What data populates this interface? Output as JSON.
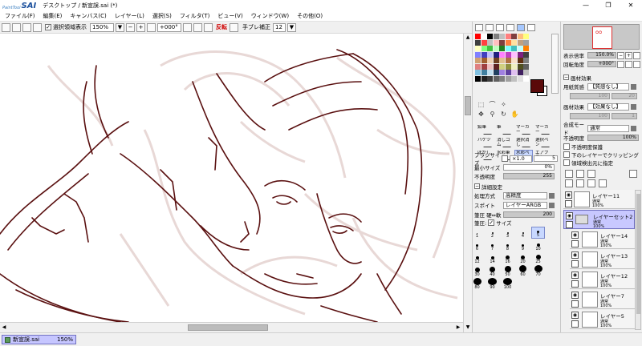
{
  "window": {
    "logo_small": "PaintTool",
    "logo_big": "SAI",
    "title": "デスクトップ / 新宣誤.sai (*)",
    "minimize": "—",
    "maximize": "❐",
    "close": "✕"
  },
  "menu": [
    "ファイル(F)",
    "編集(E)",
    "キャンバス(C)",
    "レイヤー(L)",
    "選択(S)",
    "フィルタ(T)",
    "ビュー(V)",
    "ウィンドウ(W)",
    "その他(O)"
  ],
  "toolbar": {
    "selection_display": "選択領域表示",
    "selection_checked": true,
    "zoom": "150%",
    "rotation": "+000°",
    "flip": "反転",
    "stabilizer_label": "手ブレ補正",
    "stabilizer_value": "12"
  },
  "palette_colors": [
    "#ff0000",
    "#ffffff",
    "#000000",
    "#7f7f7f",
    "#bfbfbf",
    "#ff7f7f",
    "#7f3f3f",
    "#ffbf7f",
    "#ffff7f",
    "#3f3f3f",
    "#ff4040",
    "#c0c0c0",
    "#ffc0c0",
    "#804040",
    "#ff8040",
    "#ffe0a0",
    "#c0a080",
    "#a0a0a0",
    "#ffffc0",
    "#80ff80",
    "#40c040",
    "#c0ffc0",
    "#208020",
    "#80ffff",
    "#40c0c0",
    "#c0ffff",
    "#ff8000",
    "#8080ff",
    "#4040c0",
    "#c0c0ff",
    "#202080",
    "#ff80ff",
    "#c040c0",
    "#ffc0ff",
    "#802080",
    "#404040",
    "#d0a070",
    "#a06030",
    "#f0d0b0",
    "#704020",
    "#e0c090",
    "#b07040",
    "#f8e0c8",
    "#603010",
    "#808080",
    "#e08080",
    "#a04040",
    "#f0c0c0",
    "#602020",
    "#d0d080",
    "#909040",
    "#f0f0c0",
    "#505020",
    "#606060",
    "#80c0e0",
    "#4080a0",
    "#c0e0f0",
    "#204060",
    "#a080e0",
    "#6040a0",
    "#e0c0f0",
    "#402060",
    "#c0c0c0",
    "#000000",
    "#202020",
    "#404040",
    "#606060",
    "#808080",
    "#a0a0a0",
    "#c0c0c0",
    "#e0e0e0",
    "#ffffff"
  ],
  "current_color": "#5a0a0a",
  "tools": [
    {
      "label": "鉛筆",
      "active": false
    },
    {
      "label": "筆",
      "active": false
    },
    {
      "label": "マーカー",
      "active": false
    },
    {
      "label": "マーカー",
      "active": false
    },
    {
      "label": "バケツ",
      "active": false
    },
    {
      "label": "消しゴム",
      "active": false
    },
    {
      "label": "選択消し",
      "active": false
    },
    {
      "label": "選択ペン",
      "active": false
    },
    {
      "label": "ぼかし",
      "active": false
    },
    {
      "label": "水彩筆",
      "active": false
    },
    {
      "label": "水彩ペン",
      "active": true
    },
    {
      "label": "エアブラシ",
      "active": false
    }
  ],
  "brush": {
    "size_label": "ブラシサイズ",
    "size_mult": "×1.0",
    "size_value": "5",
    "min_size_label": "最小サイズ",
    "min_size_value": "0%",
    "density_label": "不透明度",
    "density_value": "255",
    "detail_label": "詳細設定",
    "quality_label": "処理方式",
    "quality_value": "高精度",
    "edge_label": "スポイト",
    "edge_value": "レイヤーARGB",
    "hardness_label": "筆圧 硬⇔軟",
    "hardness_value": "200",
    "pressure_label": "筆圧:",
    "pressure_size": "サイズ"
  },
  "brush_sizes": [
    {
      "label": "1",
      "sel": false
    },
    {
      "label": "2",
      "sel": false
    },
    {
      "label": "3",
      "sel": false
    },
    {
      "label": "4",
      "sel": false
    },
    {
      "label": "5",
      "sel": true
    },
    {
      "label": "6",
      "sel": false
    },
    {
      "label": "7",
      "sel": false
    },
    {
      "label": "8",
      "sel": false
    },
    {
      "label": "9",
      "sel": false
    },
    {
      "label": "10",
      "sel": false
    },
    {
      "label": "12",
      "sel": false
    },
    {
      "label": "14",
      "sel": false
    },
    {
      "label": "16",
      "sel": false
    },
    {
      "label": "20",
      "sel": false
    },
    {
      "label": "25",
      "sel": false
    },
    {
      "label": "30",
      "sel": false
    },
    {
      "label": "40",
      "sel": false
    },
    {
      "label": "50",
      "sel": false
    },
    {
      "label": "60",
      "sel": false
    },
    {
      "label": "70",
      "sel": false
    },
    {
      "label": "80",
      "sel": false
    },
    {
      "label": "90",
      "sel": false
    },
    {
      "label": "100",
      "sel": false
    }
  ],
  "navigator": {
    "zoom_label": "表示倍率",
    "zoom_value": "150.0%",
    "angle_label": "回転角度",
    "angle_value": "+000°"
  },
  "paper": {
    "header": "画材効果",
    "texture_label": "用紙質感",
    "texture_value": "【質感なし】",
    "texture_v1": "100",
    "texture_v2": "20",
    "effect_label": "画材効果",
    "effect_value": "【効果なし】",
    "effect_v1": "100",
    "effect_v2": "1"
  },
  "layer_props": {
    "mode_label": "合成モード",
    "mode_value": "通常",
    "opacity_label": "不透明度",
    "opacity_value": "100%",
    "protect_label": "不透明度保護",
    "clip_label": "下のレイヤーでクリッピング",
    "select_source_label": "領域検出元に指定"
  },
  "layers": [
    {
      "name": "レイヤー11",
      "mode": "通常",
      "opacity": "100%",
      "folder": false,
      "child": false,
      "sel": false
    },
    {
      "name": "レイヤーセット2",
      "mode": "通常",
      "opacity": "100%",
      "folder": true,
      "child": false,
      "sel": true
    },
    {
      "name": "レイヤー14",
      "mode": "通常",
      "opacity": "100%",
      "folder": false,
      "child": true,
      "sel": false
    },
    {
      "name": "レイヤー13",
      "mode": "通常",
      "opacity": "100%",
      "folder": false,
      "child": true,
      "sel": false
    },
    {
      "name": "レイヤー12",
      "mode": "通常",
      "opacity": "100%",
      "folder": false,
      "child": true,
      "sel": false
    },
    {
      "name": "レイヤー7",
      "mode": "通常",
      "opacity": "100%",
      "folder": false,
      "child": true,
      "sel": false
    },
    {
      "name": "レイヤー5",
      "mode": "通常",
      "opacity": "100%",
      "folder": false,
      "child": true,
      "sel": false
    }
  ],
  "statusbar": {
    "doc_name": "新宣誤.sai",
    "doc_zoom": "150%"
  },
  "icons": {
    "eye": "◉",
    "check": "✓",
    "arrow_up": "▲",
    "arrow_down": "▼",
    "arrow_left": "◀",
    "arrow_right": "▶",
    "minus": "−"
  }
}
